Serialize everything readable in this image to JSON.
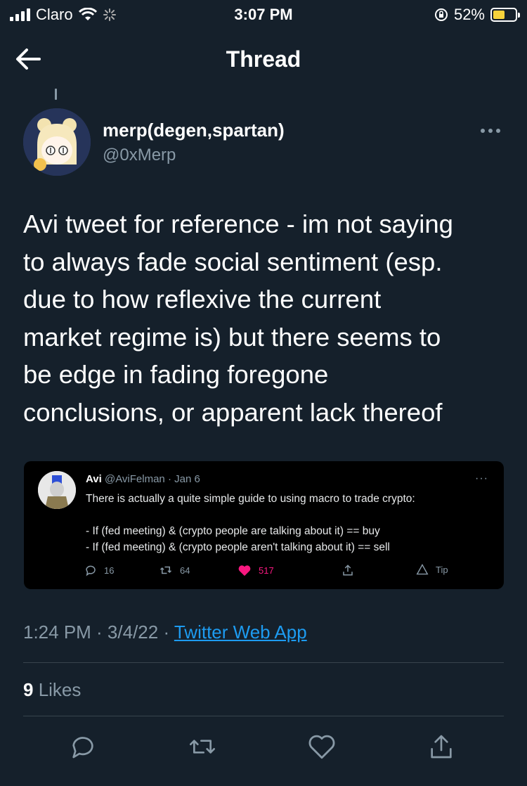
{
  "status_bar": {
    "carrier": "Claro",
    "time": "3:07 PM",
    "battery": "52%",
    "battery_level": 0.52
  },
  "nav": {
    "title": "Thread"
  },
  "tweet": {
    "display_name": "merp(degen,spartan)",
    "handle": "@0xMerp",
    "text": "Avi tweet for reference - im not saying\nto always fade social sentiment (esp.\ndue to how reflexive the current\nmarket regime is) but there seems to\nbe edge in fading foregone\nconclusions, or apparent lack thereof",
    "timestamp": "1:24 PM · 3/4/22 · ",
    "source": "Twitter Web App",
    "likes_count": "9",
    "likes_label": " Likes"
  },
  "embedded": {
    "name": "Avi",
    "meta": " @AviFelman · Jan 6",
    "more": "···",
    "text": "There is actually a quite simple guide to using macro to trade crypto:\n\n- If (fed meeting) & (crypto people are talking about it) == buy\n- If (fed meeting) & (crypto people aren't talking about it) == sell",
    "replies": "16",
    "retweets": "64",
    "likes": "517",
    "tip": "Tip"
  },
  "colors": {
    "background": "#15202b",
    "accent": "#1d9bf0",
    "muted": "#8899a6",
    "like": "#f91880",
    "divider": "#38444d"
  }
}
